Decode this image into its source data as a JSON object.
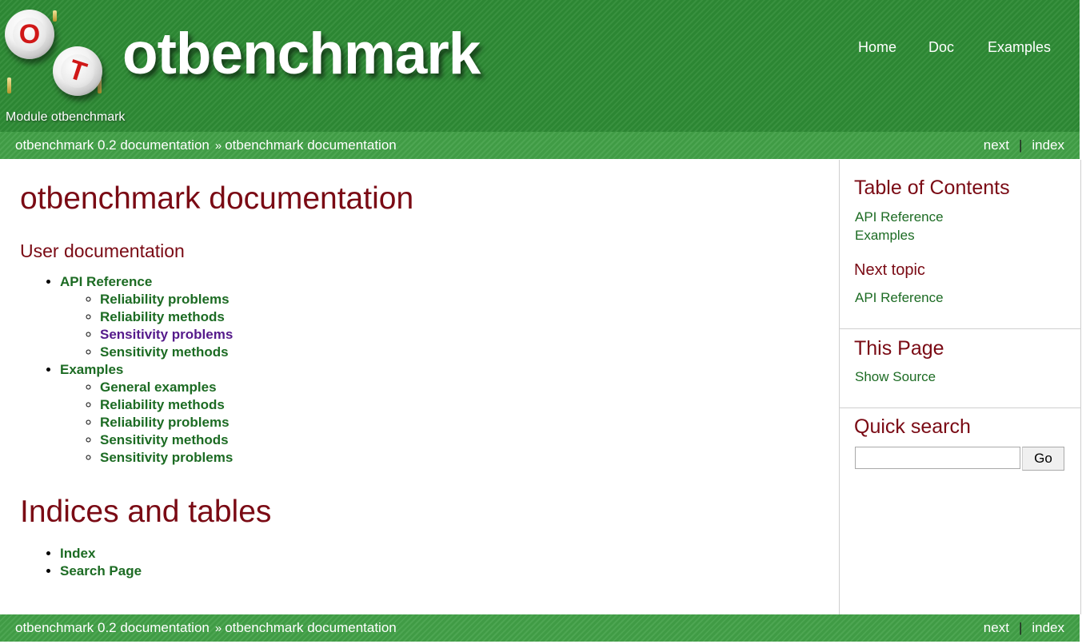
{
  "header": {
    "brand": "otbenchmark",
    "module_label": "Module otbenchmark",
    "logo_letters": [
      "O",
      "T"
    ],
    "nav": [
      "Home",
      "Doc",
      "Examples"
    ]
  },
  "related": {
    "crumbs": [
      "otbenchmark 0.2 documentation",
      "otbenchmark documentation"
    ],
    "separator": "»",
    "next": "next",
    "divider": "|",
    "index": "index"
  },
  "main": {
    "title": "otbenchmark documentation",
    "section_title": "User documentation",
    "toc": [
      {
        "label": "API Reference",
        "children": [
          "Reliability problems",
          "Reliability methods",
          "Sensitivity problems",
          "Sensitivity methods"
        ]
      },
      {
        "label": "Examples",
        "children": [
          "General examples",
          "Reliability methods",
          "Reliability problems",
          "Sensitivity methods",
          "Sensitivity problems"
        ]
      }
    ],
    "indices_title": "Indices and tables",
    "indices": [
      "Index",
      "Search Page"
    ]
  },
  "sidebar": {
    "toc_heading": "Table of Contents",
    "toc_links": [
      "API Reference",
      "Examples"
    ],
    "next_heading": "Next topic",
    "next_link": "API Reference",
    "this_page_heading": "This Page",
    "show_source": "Show Source",
    "search_heading": "Quick search",
    "search_value": "",
    "go_label": "Go"
  },
  "colors": {
    "header_green": "#2e8b35",
    "bar_green": "#42a047",
    "heading_red": "#7a0a14",
    "link_green": "#1c6b23",
    "visited_purple": "#551a8b"
  }
}
